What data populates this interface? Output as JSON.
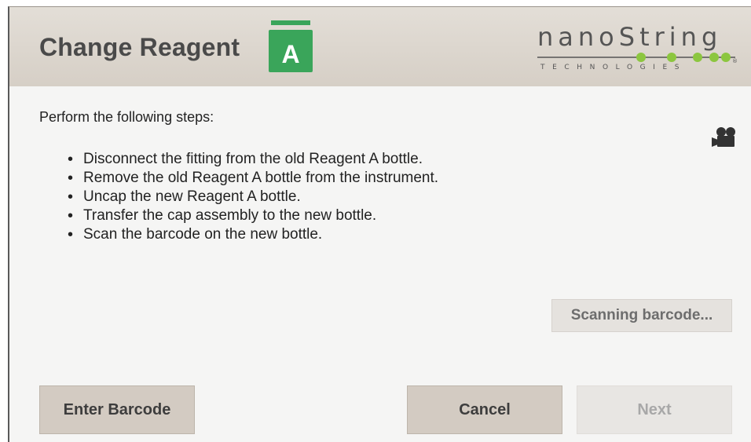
{
  "header": {
    "title": "Change Reagent",
    "reagent_letter": "A",
    "logo_word": "nanoString",
    "logo_sub": "TECHNOLOGIES",
    "logo_trademark": "®"
  },
  "body": {
    "intro": "Perform the following steps:",
    "steps": [
      "Disconnect the fitting from the old Reagent A bottle.",
      "Remove the old Reagent A bottle from the instrument.",
      "Uncap the new Reagent A bottle.",
      "Transfer the cap assembly to the new bottle.",
      "Scan the barcode on the new bottle."
    ],
    "video_icon": "video-camera-icon",
    "scan_status": "Scanning barcode..."
  },
  "footer": {
    "enter_barcode_label": "Enter Barcode",
    "cancel_label": "Cancel",
    "next_label": "Next"
  },
  "colors": {
    "reagent_green": "#3aa55a",
    "logo_dot_green": "#8cc63f",
    "header_bg": "#dcd6ce",
    "button_bg": "#d3cbc2",
    "disabled_button_bg": "#e8e6e3"
  }
}
